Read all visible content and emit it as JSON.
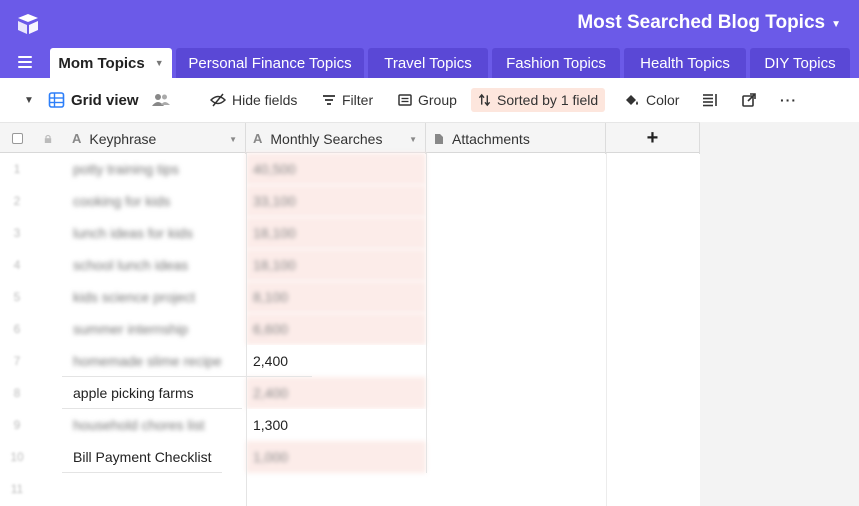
{
  "app": {
    "base_title": "Most Searched Blog Topics"
  },
  "tabs": [
    {
      "label": "Mom Topics",
      "active": true
    },
    {
      "label": "Personal Finance Topics",
      "active": false
    },
    {
      "label": "Travel Topics",
      "active": false
    },
    {
      "label": "Fashion Topics",
      "active": false
    },
    {
      "label": "Health Topics",
      "active": false
    },
    {
      "label": "DIY Topics",
      "active": false
    }
  ],
  "toolbar": {
    "view_name": "Grid view",
    "hide_fields": "Hide fields",
    "filter": "Filter",
    "group": "Group",
    "sorted": "Sorted by 1 field",
    "color": "Color"
  },
  "columns": [
    {
      "type_icon": "A",
      "label": "Keyphrase"
    },
    {
      "type_icon": "A",
      "label": "Monthly Searches"
    },
    {
      "type_icon": "file-icon",
      "label": "Attachments"
    }
  ],
  "add_column": "+",
  "rows": [
    {
      "num": "1",
      "keyphrase": "potty training tips",
      "searches": "40,500",
      "blurred": true
    },
    {
      "num": "2",
      "keyphrase": "cooking for kids",
      "searches": "33,100",
      "blurred": true
    },
    {
      "num": "3",
      "keyphrase": "lunch ideas for kids",
      "searches": "18,100",
      "blurred": true
    },
    {
      "num": "4",
      "keyphrase": "school lunch ideas",
      "searches": "18,100",
      "blurred": true
    },
    {
      "num": "5",
      "keyphrase": "kids science project",
      "searches": "8,100",
      "blurred": true
    },
    {
      "num": "6",
      "keyphrase": "summer internship",
      "searches": "6,600",
      "blurred": true
    },
    {
      "num": "7",
      "keyphrase": "homemade slime recipe",
      "searches": "2,400",
      "blurred": true,
      "searches_blurred": false
    },
    {
      "num": "8",
      "keyphrase": "apple picking farms",
      "searches": "2,400",
      "blurred": false,
      "searches_blurred": true
    },
    {
      "num": "9",
      "keyphrase": "household chores list",
      "searches": "1,300",
      "blurred": true,
      "searches_blurred": false
    },
    {
      "num": "10",
      "keyphrase": "Bill Payment Checklist",
      "searches": "1,000",
      "blurred": false,
      "searches_blurred": true
    },
    {
      "num": "11",
      "keyphrase": "",
      "searches": "",
      "blurred": false,
      "empty": true
    }
  ],
  "colors": {
    "brand": "#6b5ae8",
    "sorted_bg": "#fde6dd",
    "sort_column_bg": "#fcece9"
  }
}
